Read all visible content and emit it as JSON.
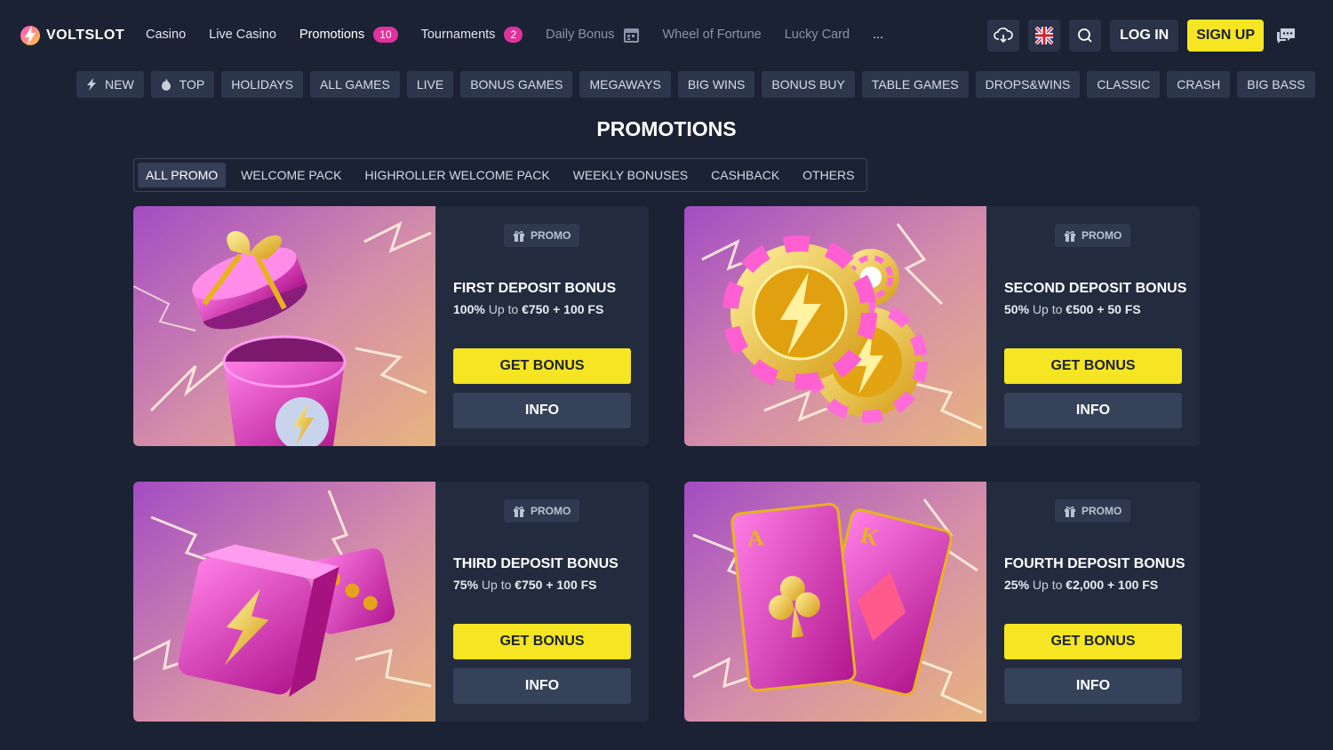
{
  "brand": {
    "name": "VOLTSLOT",
    "logo_icon": "bolt-icon",
    "accent": "#f5e523",
    "badge_color": "#e0329c",
    "background": "#1b2233"
  },
  "nav": {
    "casino": "Casino",
    "live_casino": "Live Casino",
    "promotions": {
      "label": "Promotions",
      "badge": "10"
    },
    "tournaments": {
      "label": "Tournaments",
      "badge": "2"
    },
    "daily_bonus": "Daily Bonus",
    "wheel": "Wheel of Fortune",
    "lucky_card": "Lucky Card",
    "more": "..."
  },
  "header_actions": {
    "download_icon": "cloud-download-icon",
    "language_icon": "uk-flag-icon",
    "search_icon": "search-icon",
    "login": "LOG IN",
    "signup": "SIGN UP",
    "chat_icon": "chat-icon"
  },
  "categories": [
    "NEW",
    "TOP",
    "HOLIDAYS",
    "ALL GAMES",
    "LIVE",
    "BONUS GAMES",
    "MEGAWAYS",
    "BIG WINS",
    "BONUS BUY",
    "TABLE GAMES",
    "DROPS&WINS",
    "CLASSIC",
    "CRASH",
    "BIG BASS"
  ],
  "page_title": "PROMOTIONS",
  "tabs": [
    "ALL PROMO",
    "WELCOME PACK",
    "HIGHROLLER WELCOME PACK",
    "WEEKLY BONUSES",
    "CASHBACK",
    "OTHERS"
  ],
  "promos": [
    {
      "tag": "PROMO",
      "title": "FIRST DEPOSIT BONUS",
      "percent": "100%",
      "upto": " Up to ",
      "amount": "€750 + 100 FS",
      "cta": "GET BONUS",
      "info": "INFO",
      "art": "gift-box"
    },
    {
      "tag": "PROMO",
      "title": "SECOND DEPOSIT BONUS",
      "percent": "50%",
      "upto": " Up to ",
      "amount": "€500 + 50 FS",
      "cta": "GET BONUS",
      "info": "INFO",
      "art": "casino-chips"
    },
    {
      "tag": "PROMO",
      "title": "THIRD DEPOSIT BONUS",
      "percent": "75%",
      "upto": " Up to ",
      "amount": "€750 + 100 FS",
      "cta": "GET BONUS",
      "info": "INFO",
      "art": "dice"
    },
    {
      "tag": "PROMO",
      "title": "FOURTH DEPOSIT BONUS",
      "percent": "25%",
      "upto": " Up to ",
      "amount": "€2,000 + 100 FS",
      "cta": "GET BONUS",
      "info": "INFO",
      "art": "playing-cards"
    }
  ]
}
